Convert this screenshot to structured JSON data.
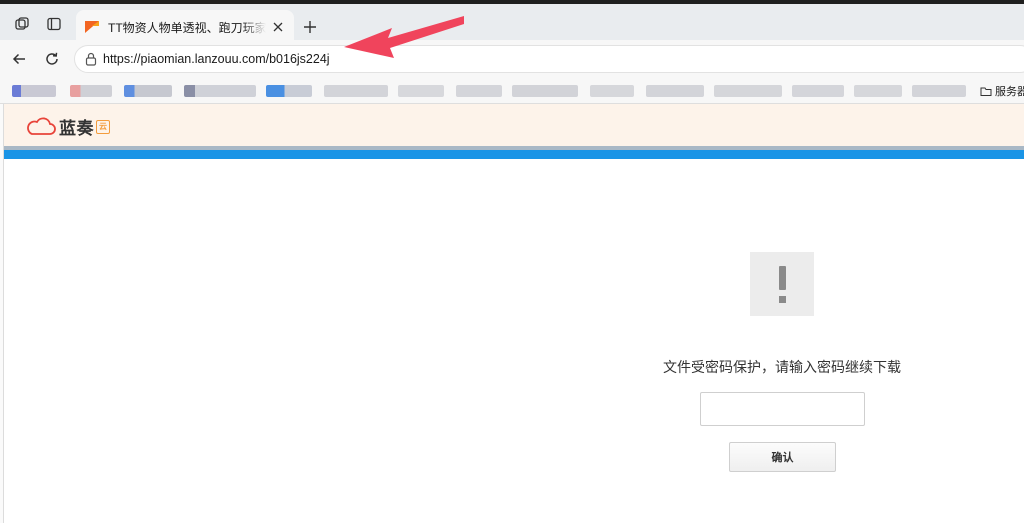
{
  "browser": {
    "tab": {
      "title": "TT物资人物单透视、跑刀玩家必备"
    },
    "address": {
      "scheme": "https://",
      "host": "piaomian.lanzouu.com",
      "path": "/b016js224j"
    },
    "bookmarks": {
      "folder_label": "服务器"
    }
  },
  "site": {
    "logo_text": "蓝奏",
    "logo_badge": "云"
  },
  "content": {
    "message": "文件受密码保护，请输入密码继续下载",
    "password_value": "",
    "confirm_label": "确认"
  },
  "colors": {
    "accent_blue": "#1a94e6",
    "header_bg": "#fdf3ea",
    "logo_orange": "#f39c3d",
    "annotation_arrow": "#f0445c"
  }
}
